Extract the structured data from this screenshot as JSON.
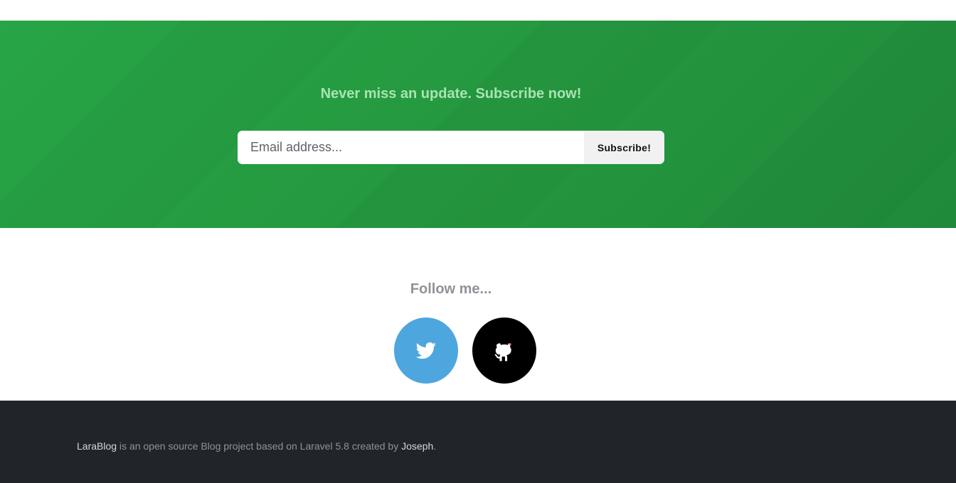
{
  "subscribe": {
    "title": "Never miss an update. Subscribe now!",
    "email_placeholder": "Email address...",
    "button_label": "Subscribe!"
  },
  "follow": {
    "title": "Follow me...",
    "twitter_icon": "twitter-icon",
    "github_icon": "github-icon"
  },
  "footer": {
    "brand": "LaraBlog",
    "middle": " is an open source Blog project based on Laravel 5.8 created by ",
    "author": "Joseph",
    "end": "."
  },
  "colors": {
    "green": "#27a547",
    "twitter": "#4ea6de",
    "github": "#000000",
    "footer": "#212529"
  }
}
